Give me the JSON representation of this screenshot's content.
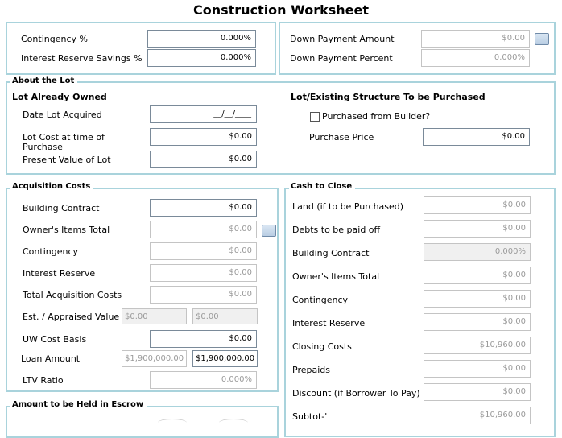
{
  "title": "Construction Worksheet",
  "top_left": {
    "contingency_label": "Contingency %",
    "contingency_value": "0.000%",
    "interest_reserve_label": "Interest Reserve Savings %",
    "interest_reserve_value": "0.000%"
  },
  "top_right": {
    "down_payment_amount_label": "Down Payment Amount",
    "down_payment_amount_value": "$0.00",
    "down_payment_percent_label": "Down Payment Percent",
    "down_payment_percent_value": "0.000%"
  },
  "about_lot": {
    "legend": "About the Lot",
    "owned_heading": "Lot Already Owned",
    "date_acquired_label": "Date Lot Acquired",
    "date_acquired_value": "__/__/____",
    "lot_cost_label": "Lot Cost at time of Purchase",
    "lot_cost_value": "$0.00",
    "present_value_label": "Present Value of Lot",
    "present_value_value": "$0.00",
    "purchase_heading": "Lot/Existing Structure To be Purchased",
    "purchased_from_builder_label": "Purchased from Builder?",
    "purchased_from_builder_checked": false,
    "purchase_price_label": "Purchase Price",
    "purchase_price_value": "$0.00"
  },
  "acquisition": {
    "legend": "Acquisition Costs",
    "building_contract_label": "Building Contract",
    "building_contract_value": "$0.00",
    "owners_items_label": "Owner's Items Total",
    "owners_items_value": "$0.00",
    "contingency_label": "Contingency",
    "contingency_value": "$0.00",
    "interest_reserve_label": "Interest Reserve",
    "interest_reserve_value": "$0.00",
    "total_label": "Total Acquisition Costs",
    "total_value": "$0.00",
    "est_value_label": "Est. / Appraised Value",
    "est_value_1": "$0.00",
    "est_value_2": "$0.00",
    "uw_cost_label": "UW Cost Basis",
    "uw_cost_value": "$0.00",
    "loan_amount_label": "Loan Amount",
    "loan_amount_1": "$1,900,000.00",
    "loan_amount_2": "$1,900,000.00",
    "ltv_label": "LTV Ratio",
    "ltv_value": "0.000%"
  },
  "escrow": {
    "legend": "Amount to be Held in Escrow"
  },
  "cash_to_close": {
    "legend": "Cash to Close",
    "land_label": "Land (if to be Purchased)",
    "land_value": "$0.00",
    "debts_label": "Debts to be paid off",
    "debts_value": "$0.00",
    "building_contract_label": "Building Contract",
    "building_contract_value": "0.000%",
    "owners_items_label": "Owner's Items Total",
    "owners_items_value": "$0.00",
    "contingency_label": "Contingency",
    "contingency_value": "$0.00",
    "interest_reserve_label": "Interest Reserve",
    "interest_reserve_value": "$0.00",
    "closing_costs_label": "Closing Costs",
    "closing_costs_value": "$10,960.00",
    "prepaids_label": "Prepaids",
    "prepaids_value": "$0.00",
    "discount_label": "Discount (if Borrower To Pay)",
    "discount_value": "$0.00",
    "subtotal_label": "Subtot-'",
    "subtotal_value": "$10,960.00"
  }
}
